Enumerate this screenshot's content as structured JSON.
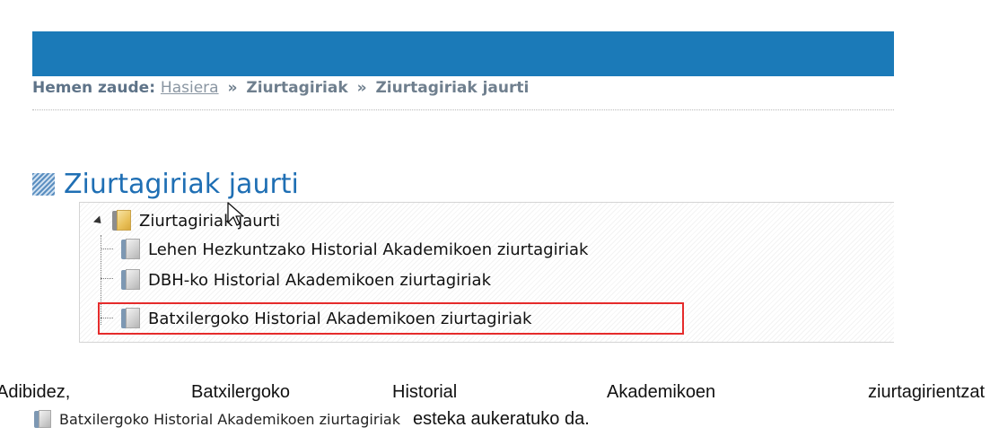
{
  "breadcrumb": {
    "label": "Hemen zaude:",
    "home_link": "Hasiera",
    "separator": "»",
    "level1": "Ziurtagiriak",
    "current": "Ziurtagiriak jaurti"
  },
  "page": {
    "title": "Ziurtagiriak jaurti"
  },
  "tree": {
    "root": {
      "label": "Ziurtagiriak jaurti",
      "icon": "folder-icon"
    },
    "children": [
      {
        "label": "Lehen Hezkuntzako Historial Akademikoen ziurtagiriak",
        "icon": "book-icon"
      },
      {
        "label": "DBH-ko Historial Akademikoen ziurtagiriak",
        "icon": "book-icon"
      },
      {
        "label": "Batxilergoko Historial Akademikoen ziurtagiriak",
        "icon": "book-icon",
        "highlighted": true
      }
    ]
  },
  "caption": {
    "words": [
      "Adibidez,",
      "Batxilergoko",
      "Historial",
      "Akademikoen",
      "ziurtagirientzat"
    ],
    "link_label": "Batxilergoko Historial Akademikoen ziurtagiriak",
    "tail": "esteka aukeratuko da."
  },
  "colors": {
    "top_bar": "#1b7ab8",
    "title": "#1f6fb4",
    "highlight": "#e52b2b"
  }
}
